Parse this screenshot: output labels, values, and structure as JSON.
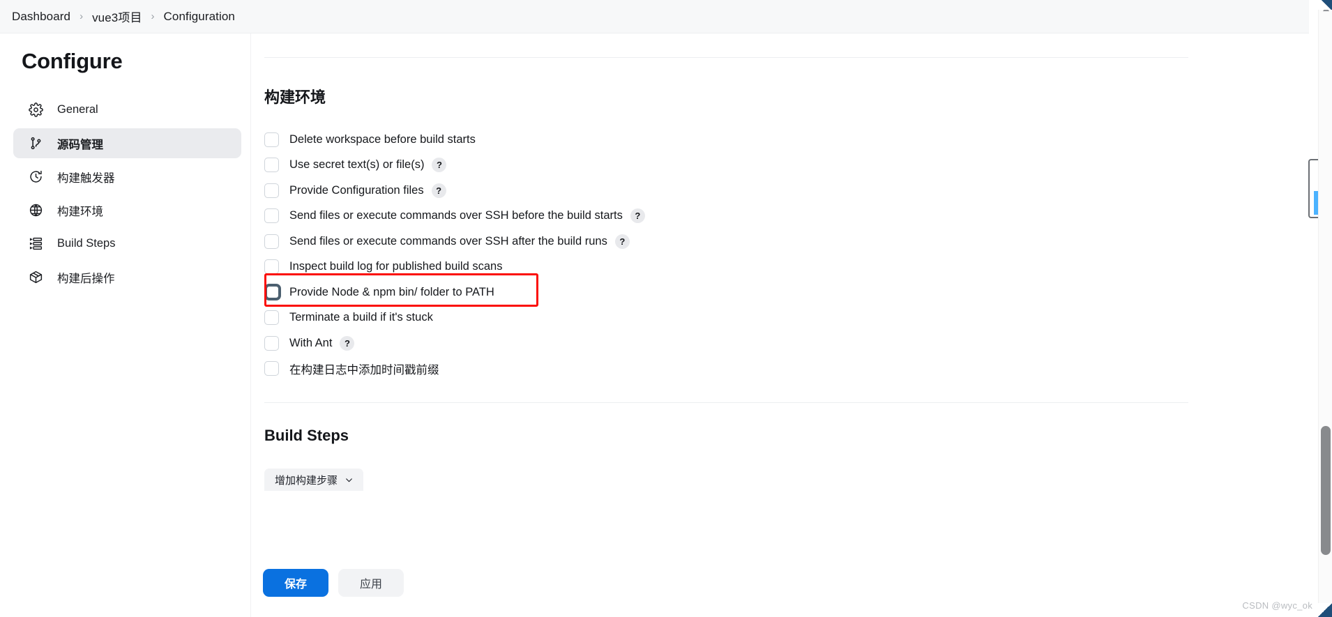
{
  "breadcrumb": {
    "items": [
      "Dashboard",
      "vue3项目",
      "Configuration"
    ],
    "separator": "›"
  },
  "sidebar": {
    "title": "Configure",
    "items": [
      {
        "label": "General",
        "icon": "gear-icon",
        "active": false
      },
      {
        "label": "源码管理",
        "icon": "source-branch-icon",
        "active": true
      },
      {
        "label": "构建触发器",
        "icon": "clock-icon",
        "active": false
      },
      {
        "label": "构建环境",
        "icon": "globe-icon",
        "active": false
      },
      {
        "label": "Build Steps",
        "icon": "list-steps-icon",
        "active": false
      },
      {
        "label": "构建后操作",
        "icon": "package-icon",
        "active": false
      }
    ]
  },
  "main": {
    "build_environment": {
      "title": "构建环境",
      "checkboxes": [
        {
          "label": "Delete workspace before build starts",
          "checked": false,
          "help": false,
          "focused": false,
          "highlighted": false
        },
        {
          "label": "Use secret text(s) or file(s)",
          "checked": false,
          "help": true,
          "focused": false,
          "highlighted": false
        },
        {
          "label": "Provide Configuration files",
          "checked": false,
          "help": true,
          "focused": false,
          "highlighted": false
        },
        {
          "label": "Send files or execute commands over SSH before the build starts",
          "checked": false,
          "help": true,
          "focused": false,
          "highlighted": false
        },
        {
          "label": "Send files or execute commands over SSH after the build runs",
          "checked": false,
          "help": true,
          "focused": false,
          "highlighted": false
        },
        {
          "label": "Inspect build log for published build scans",
          "checked": false,
          "help": false,
          "focused": false,
          "highlighted": false
        },
        {
          "label": "Provide Node & npm bin/ folder to PATH",
          "checked": false,
          "help": false,
          "focused": true,
          "highlighted": true
        },
        {
          "label": "Terminate a build if it's stuck",
          "checked": false,
          "help": false,
          "focused": false,
          "highlighted": false
        },
        {
          "label": "With Ant",
          "checked": false,
          "help": true,
          "focused": false,
          "highlighted": false
        },
        {
          "label": "在构建日志中添加时间戳前缀",
          "checked": false,
          "help": false,
          "focused": false,
          "highlighted": false
        }
      ],
      "help_badge_glyph": "?"
    },
    "build_steps": {
      "title": "Build Steps",
      "add_step_label": "增加构建步骤",
      "chevron": "chevron-down-icon"
    }
  },
  "footer": {
    "save_label": "保存",
    "apply_label": "应用"
  },
  "scrollbar": {
    "up_arrow": "triangle-up-icon",
    "down_arrow": "triangle-down-icon"
  },
  "watermark": "CSDN @wyc_ok",
  "colors": {
    "accent_blue": "#0a71e0",
    "highlight_red": "#fb0c06",
    "sidebar_active_bg": "#eaebee",
    "focus_checkbox": "#4c6070"
  }
}
